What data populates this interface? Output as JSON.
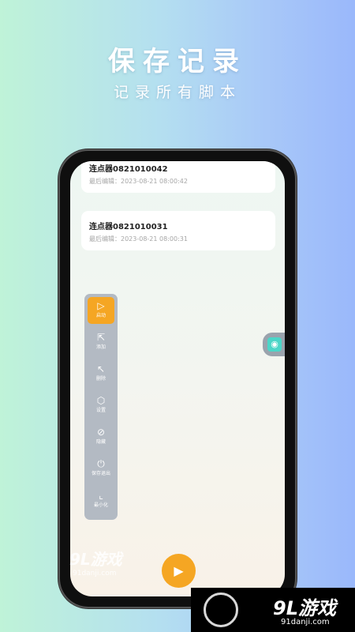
{
  "header": {
    "title": "保存记录",
    "subtitle": "记录所有脚本"
  },
  "records": [
    {
      "name": "连点器0821010042",
      "time": "最后编辑：2023-08-21 08:00:42"
    },
    {
      "name": "连点器0821010031",
      "time": "最后编辑：2023-08-21 08:00:31"
    }
  ],
  "toolbar": [
    {
      "icon": "play-icon",
      "glyph": "▷",
      "label": "启动",
      "active": true
    },
    {
      "icon": "add-pointer-icon",
      "glyph": "⇱",
      "label": "添加",
      "active": false
    },
    {
      "icon": "swipe-pointer-icon",
      "glyph": "↖",
      "label": "删除",
      "active": false
    },
    {
      "icon": "settings-icon",
      "glyph": "⬡",
      "label": "设置",
      "active": false
    },
    {
      "icon": "hide-icon",
      "glyph": "⊘",
      "label": "隐藏",
      "active": false
    },
    {
      "icon": "power-icon",
      "glyph": "⏻",
      "label": "保存退出",
      "active": false
    },
    {
      "icon": "minimize-icon",
      "glyph": "⌞",
      "label": "最小化",
      "active": false
    }
  ],
  "side_tab": {
    "icon": "app-icon",
    "glyph": "◉"
  },
  "play_button": {
    "icon": "play-icon",
    "glyph": "▶"
  },
  "watermarks": {
    "left_logo": "9L游戏",
    "left_url": "91danji.com",
    "right_logo": "9L游戏",
    "right_url": "91danji.com"
  },
  "colors": {
    "accent": "#f5a623",
    "toolbar_bg": "#b3bac3",
    "side_icon": "#4bd6c8"
  }
}
